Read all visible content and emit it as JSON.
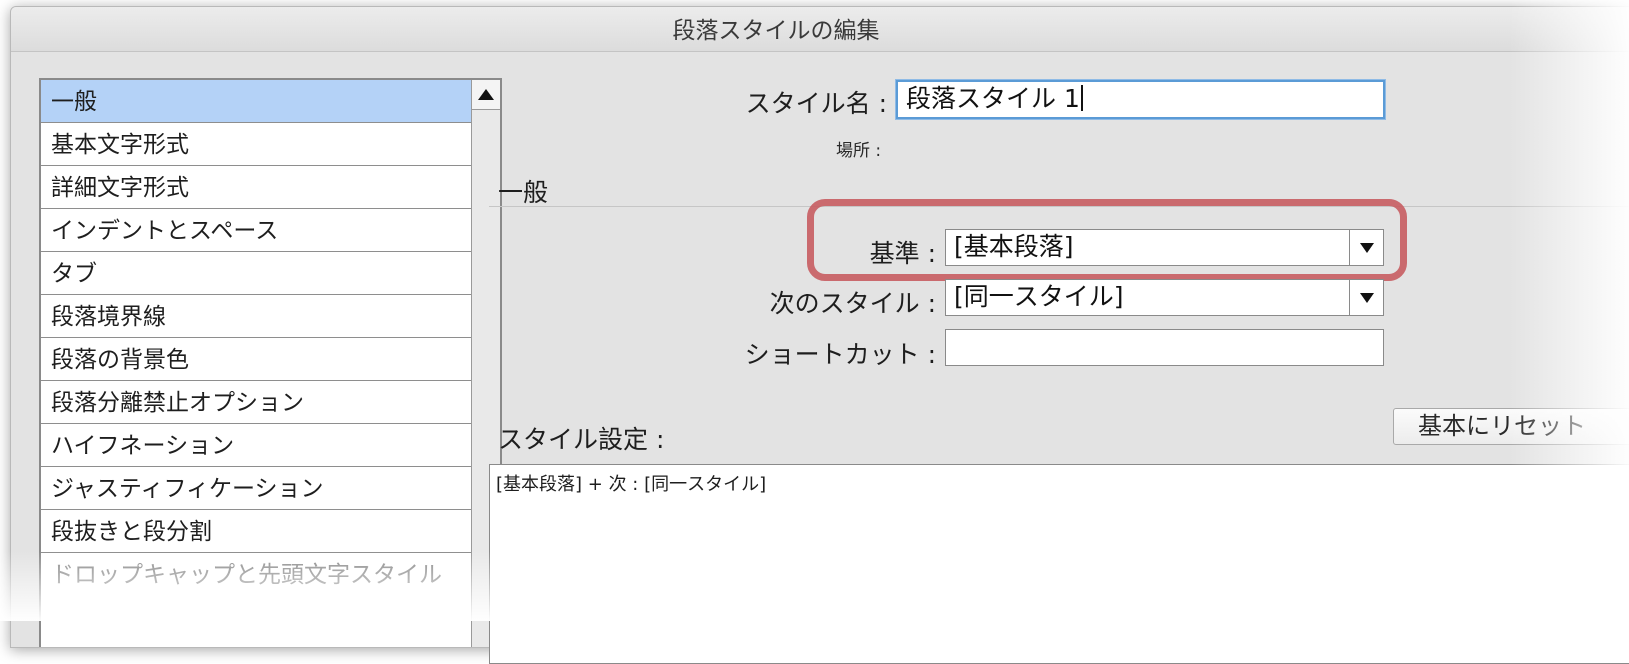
{
  "window": {
    "title": "段落スタイルの編集"
  },
  "sidebar": {
    "items": [
      {
        "label": "一般",
        "selected": true
      },
      {
        "label": "基本文字形式"
      },
      {
        "label": "詳細文字形式"
      },
      {
        "label": "インデントとスペース"
      },
      {
        "label": "タブ"
      },
      {
        "label": "段落境界線"
      },
      {
        "label": "段落の背景色"
      },
      {
        "label": "段落分離禁止オプション"
      },
      {
        "label": "ハイフネーション"
      },
      {
        "label": "ジャスティフィケーション"
      },
      {
        "label": "段抜きと段分割"
      },
      {
        "label": "ドロップキャップと先頭文字スタイル"
      }
    ]
  },
  "form": {
    "style_name_label": "スタイル名 :",
    "style_name_value": "段落スタイル 1",
    "location_label": "場所 :",
    "section_title": "一般",
    "based_on_label": "基準 :",
    "based_on_value": "[基本段落]",
    "next_style_label": "次のスタイル :",
    "next_style_value": "[同一スタイル]",
    "shortcut_label": "ショートカット :",
    "shortcut_value": "",
    "style_settings_label": "スタイル設定 :",
    "reset_button_label": "基本にリセット",
    "style_settings_text": "[基本段落] + 次 : [同一スタイル]"
  },
  "colors": {
    "selection": "#b4d2f7",
    "highlight_annotation": "#c65c60",
    "focus_ring": "#5b9bd6"
  }
}
